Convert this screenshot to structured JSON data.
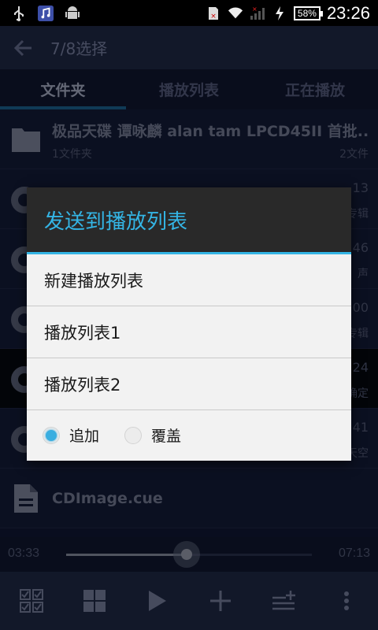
{
  "status_bar": {
    "time": "23:26",
    "battery": "58%"
  },
  "app_bar": {
    "title": "7/8选择"
  },
  "tabs": [
    {
      "label": "文件夹",
      "active": true
    },
    {
      "label": "播放列表",
      "active": false
    },
    {
      "label": "正在播放",
      "active": false
    }
  ],
  "list": {
    "folder": {
      "title": "极品天碟 谭咏麟 alan tam LPCD45II 首批...",
      "subtitle": "1文件夹",
      "count": "2文件"
    },
    "partial_rows": [
      {
        "right_top": "13",
        "right_bottom": "专辑"
      },
      {
        "right_top": "46",
        "right_bottom": "声"
      },
      {
        "right_top": "00",
        "right_bottom": "专辑"
      },
      {
        "right_top": "24",
        "right_bottom": "确定"
      },
      {
        "right_top": "41",
        "right_bottom": "天空"
      }
    ],
    "cue_file": {
      "title": "CDImage.cue"
    }
  },
  "player": {
    "elapsed": "03:33",
    "duration": "07:13",
    "progress": 0.49
  },
  "dialog": {
    "title": "发送到播放列表",
    "items": [
      "新建播放列表",
      "播放列表1",
      "播放列表2"
    ],
    "options": {
      "append_label": "追加",
      "overwrite_label": "覆盖",
      "selected": "append"
    }
  },
  "colors": {
    "accent": "#34b5e5",
    "dialog_bg": "#f2f2f2",
    "app_bar": "#1d2540"
  }
}
